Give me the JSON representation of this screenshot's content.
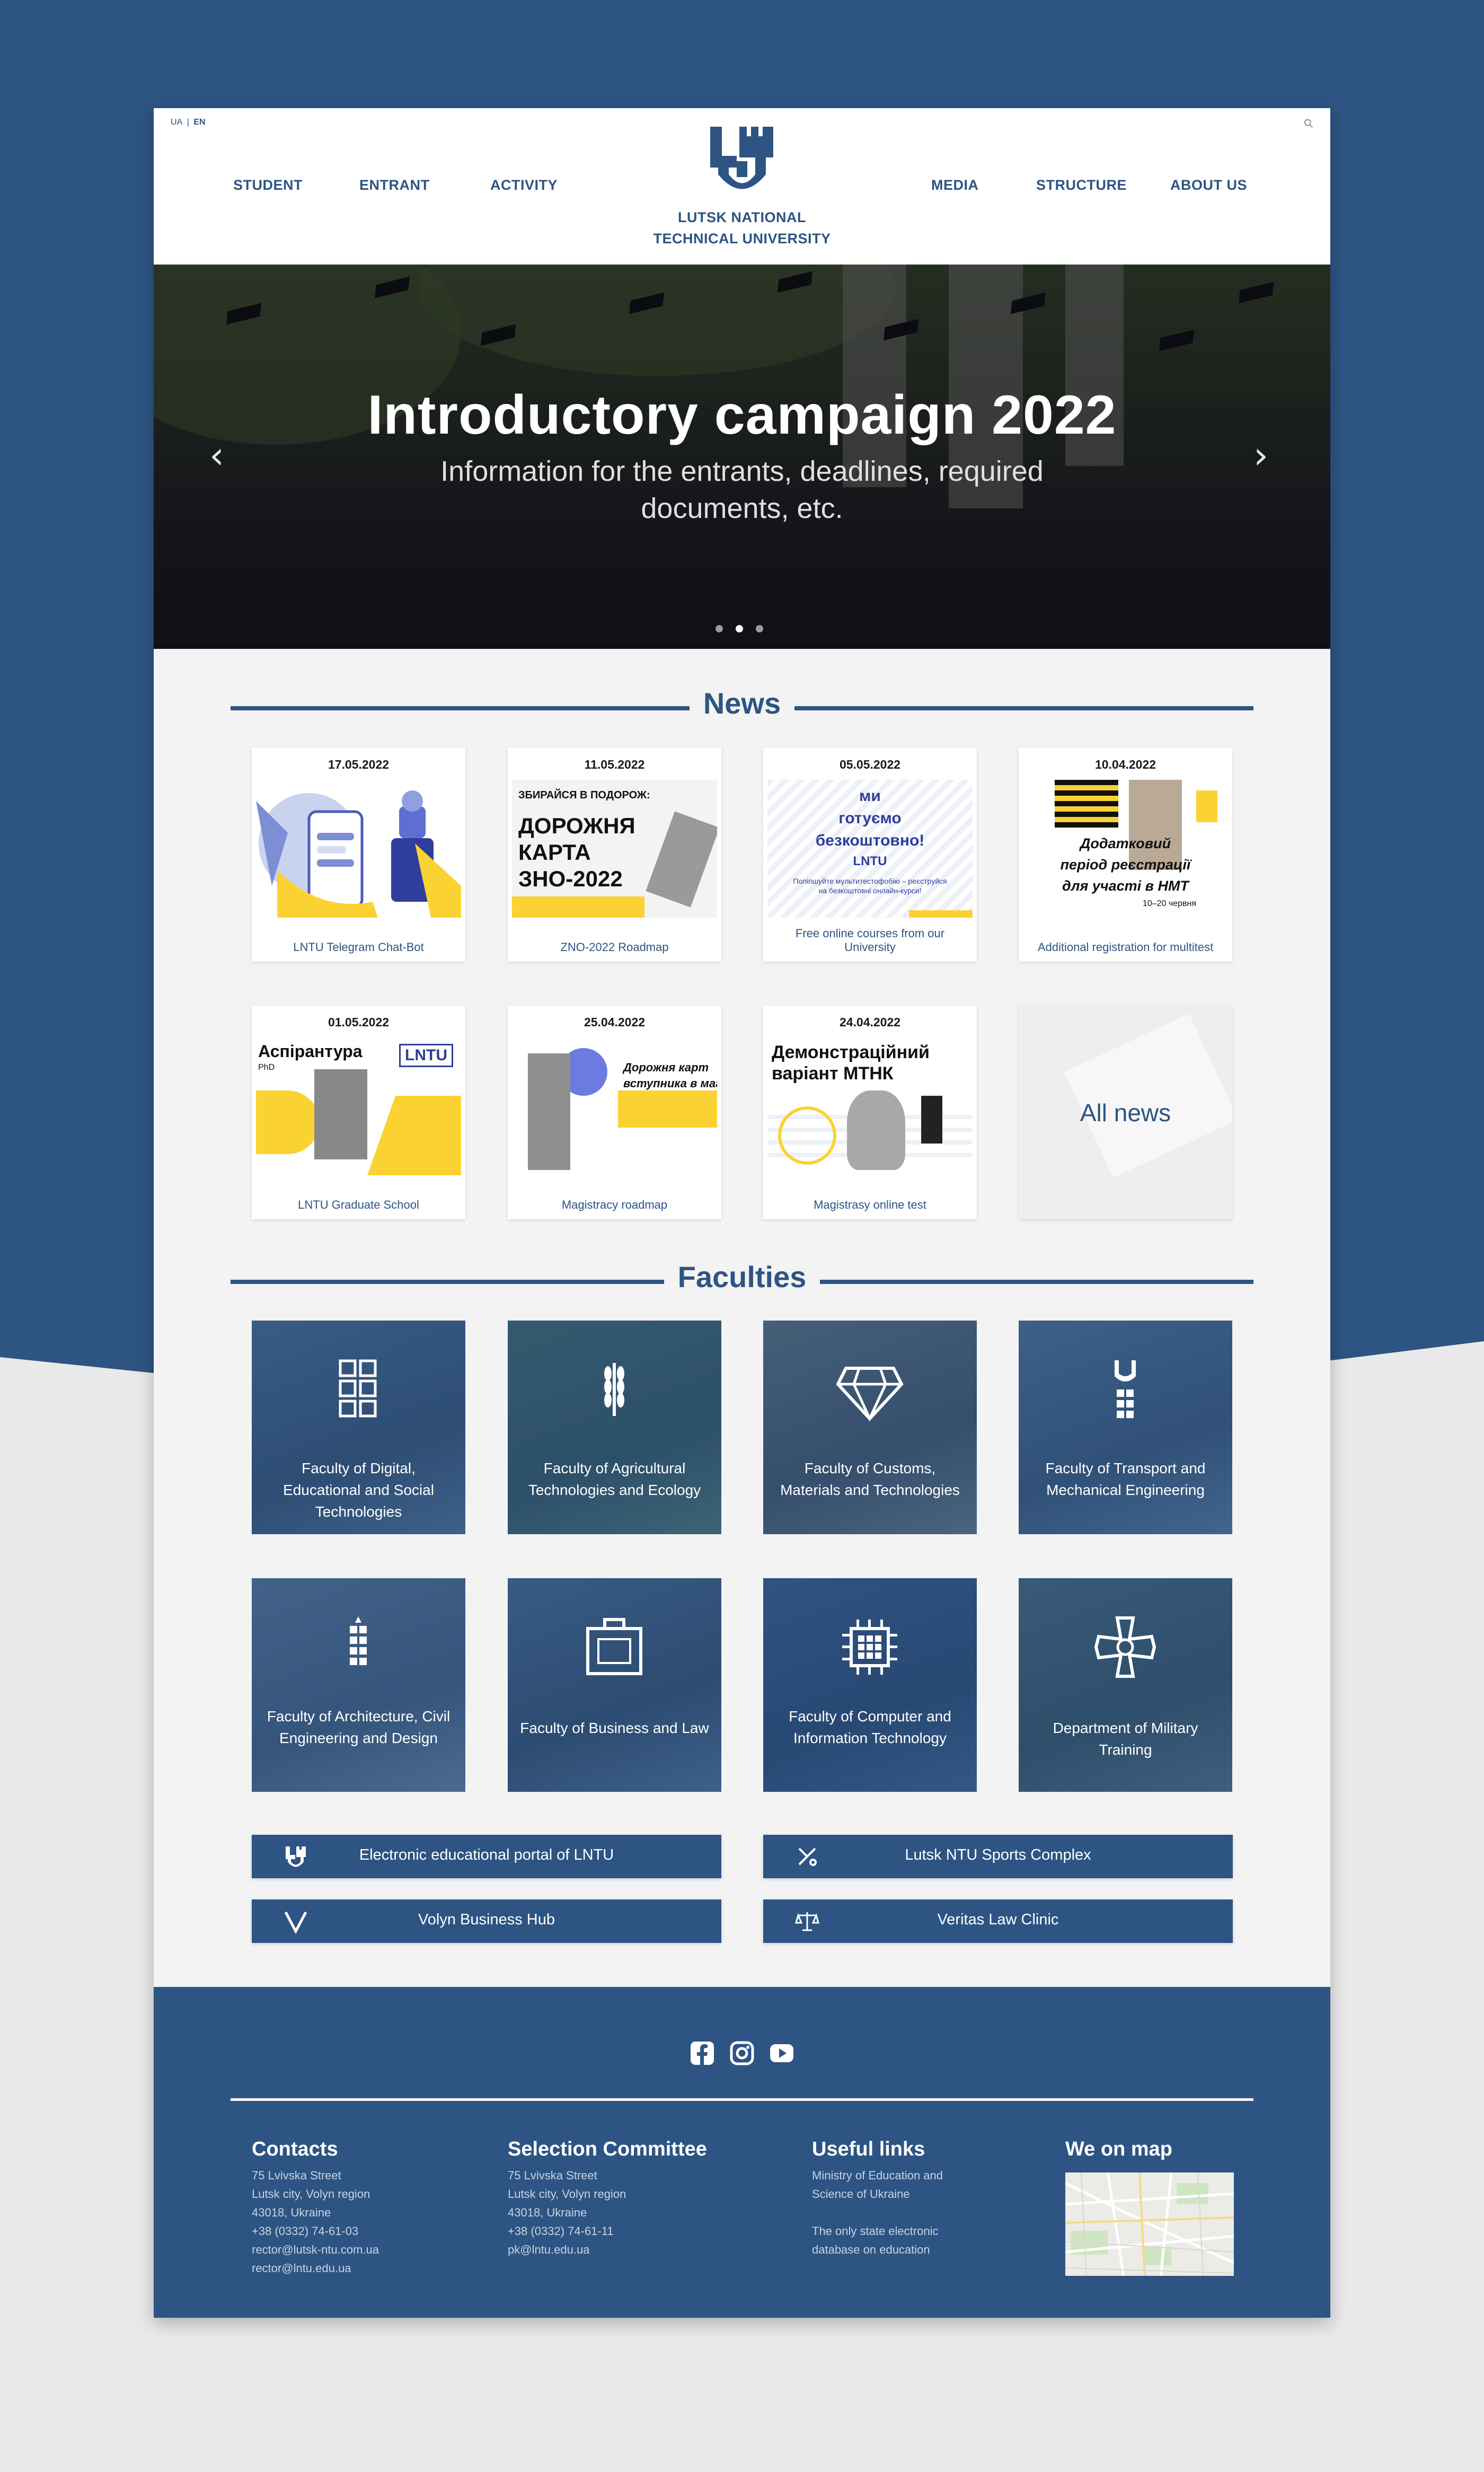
{
  "colors": {
    "brand": "#2d5483",
    "accent": "#fbd233",
    "background": "#f3f3f3"
  },
  "header": {
    "lang": [
      "UA",
      "|",
      "EN"
    ],
    "nav_left": [
      "STUDENT",
      "ENTRANT",
      "ACTIVITY"
    ],
    "nav_right": [
      "MEDIA",
      "STRUCTURE",
      "ABOUT US"
    ],
    "university_line1": "LUTSK NATIONAL",
    "university_line2": "TECHNICAL UNIVERSITY",
    "search_icon": "search-icon"
  },
  "hero": {
    "title": "Introductory campaign 2022",
    "subtitle": "Information for the entrants, deadlines, required documents, etc.",
    "prev_icon": "chevron-left-icon",
    "next_icon": "chevron-right-icon",
    "active_slide": 2,
    "slide_count": 3
  },
  "news": {
    "heading": "News",
    "items": [
      {
        "date": "17.05.2022",
        "caption": "LNTU Telegram Chat-Bot"
      },
      {
        "date": "11.05.2022",
        "caption": "ZNO-2022 Roadmap",
        "art_text": [
          "ЗБИРАЙСЯ В ПОДОРОЖ:",
          "ДОРОЖНЯ",
          "КАРТА",
          "ЗНО-2022"
        ]
      },
      {
        "date": "05.05.2022",
        "caption": "Free online courses from our University",
        "art_text": [
          "ми",
          "готуємо",
          "безкоштовно!",
          "LNTU",
          "Поліпшуйте мультитестофобію – реєструйся",
          "на безкоштовні онлайн-курси!"
        ]
      },
      {
        "date": "10.04.2022",
        "caption": "Additional registration for multitest",
        "art_text": [
          "Додатковий",
          "період реєстрації",
          "для участі в НМТ",
          "10–20 червня"
        ]
      },
      {
        "date": "01.05.2022",
        "caption": "LNTU Graduate School",
        "art_text": [
          "Аспірантура",
          "PhD",
          "LNTU"
        ]
      },
      {
        "date": "25.04.2022",
        "caption": "Magistracy roadmap",
        "art_text": [
          "Дорожня карт",
          "вступника в магіст"
        ]
      },
      {
        "date": "24.04.2022",
        "caption": "Magistrasy online test",
        "art_text": [
          "Демонстраційний",
          "варіант МТНК"
        ]
      }
    ],
    "all_news": "All news"
  },
  "faculties": {
    "heading": "Faculties",
    "items": [
      {
        "name": "Faculty of Digital, Educational and Social Technologies",
        "icon": "grid-icon"
      },
      {
        "name": "Faculty of Agricultural Technologies and Ecology",
        "icon": "wheat-icon"
      },
      {
        "name": "Faculty of Customs, Materials and Technologies",
        "icon": "diamond-icon"
      },
      {
        "name": "Faculty of Transport and Mechanical Engineering",
        "icon": "gear-tower-icon"
      },
      {
        "name": "Faculty of Architecture, Civil Engineering and Design",
        "icon": "building-icon"
      },
      {
        "name": "Faculty of Business and Law",
        "icon": "briefcase-icon"
      },
      {
        "name": "Faculty of Computer and Information Technology",
        "icon": "chip-icon"
      },
      {
        "name": "Department of Military Training",
        "icon": "cross-emblem-icon"
      }
    ]
  },
  "links": [
    {
      "label": "Electronic educational portal of LNTU",
      "icon": "lntu-logo-icon"
    },
    {
      "label": "Lutsk NTU Sports Complex",
      "icon": "sports-icon"
    },
    {
      "label": "Volyn Business Hub",
      "icon": "v-logo-icon"
    },
    {
      "label": "Veritas Law Clinic",
      "icon": "scales-icon"
    }
  ],
  "footer": {
    "social": [
      "facebook-icon",
      "instagram-icon",
      "youtube-icon"
    ],
    "contacts": {
      "title": "Contacts",
      "lines": [
        "75 Lvivska Street",
        "Lutsk city, Volyn region",
        "43018, Ukraine",
        "+38 (0332) 74-61-03",
        "rector@lutsk-ntu.com.ua",
        "rector@lntu.edu.ua"
      ]
    },
    "committee": {
      "title": "Selection Committee",
      "lines": [
        "75 Lvivska Street",
        "Lutsk city, Volyn region",
        "43018, Ukraine",
        "+38 (0332) 74-61-11",
        "pk@lntu.edu.ua"
      ]
    },
    "useful": {
      "title": "Useful links",
      "lines": [
        "Ministry of Education and",
        "Science of Ukraine",
        "",
        "The only state electronic",
        "database on education"
      ]
    },
    "map": {
      "title": "We on map"
    }
  }
}
